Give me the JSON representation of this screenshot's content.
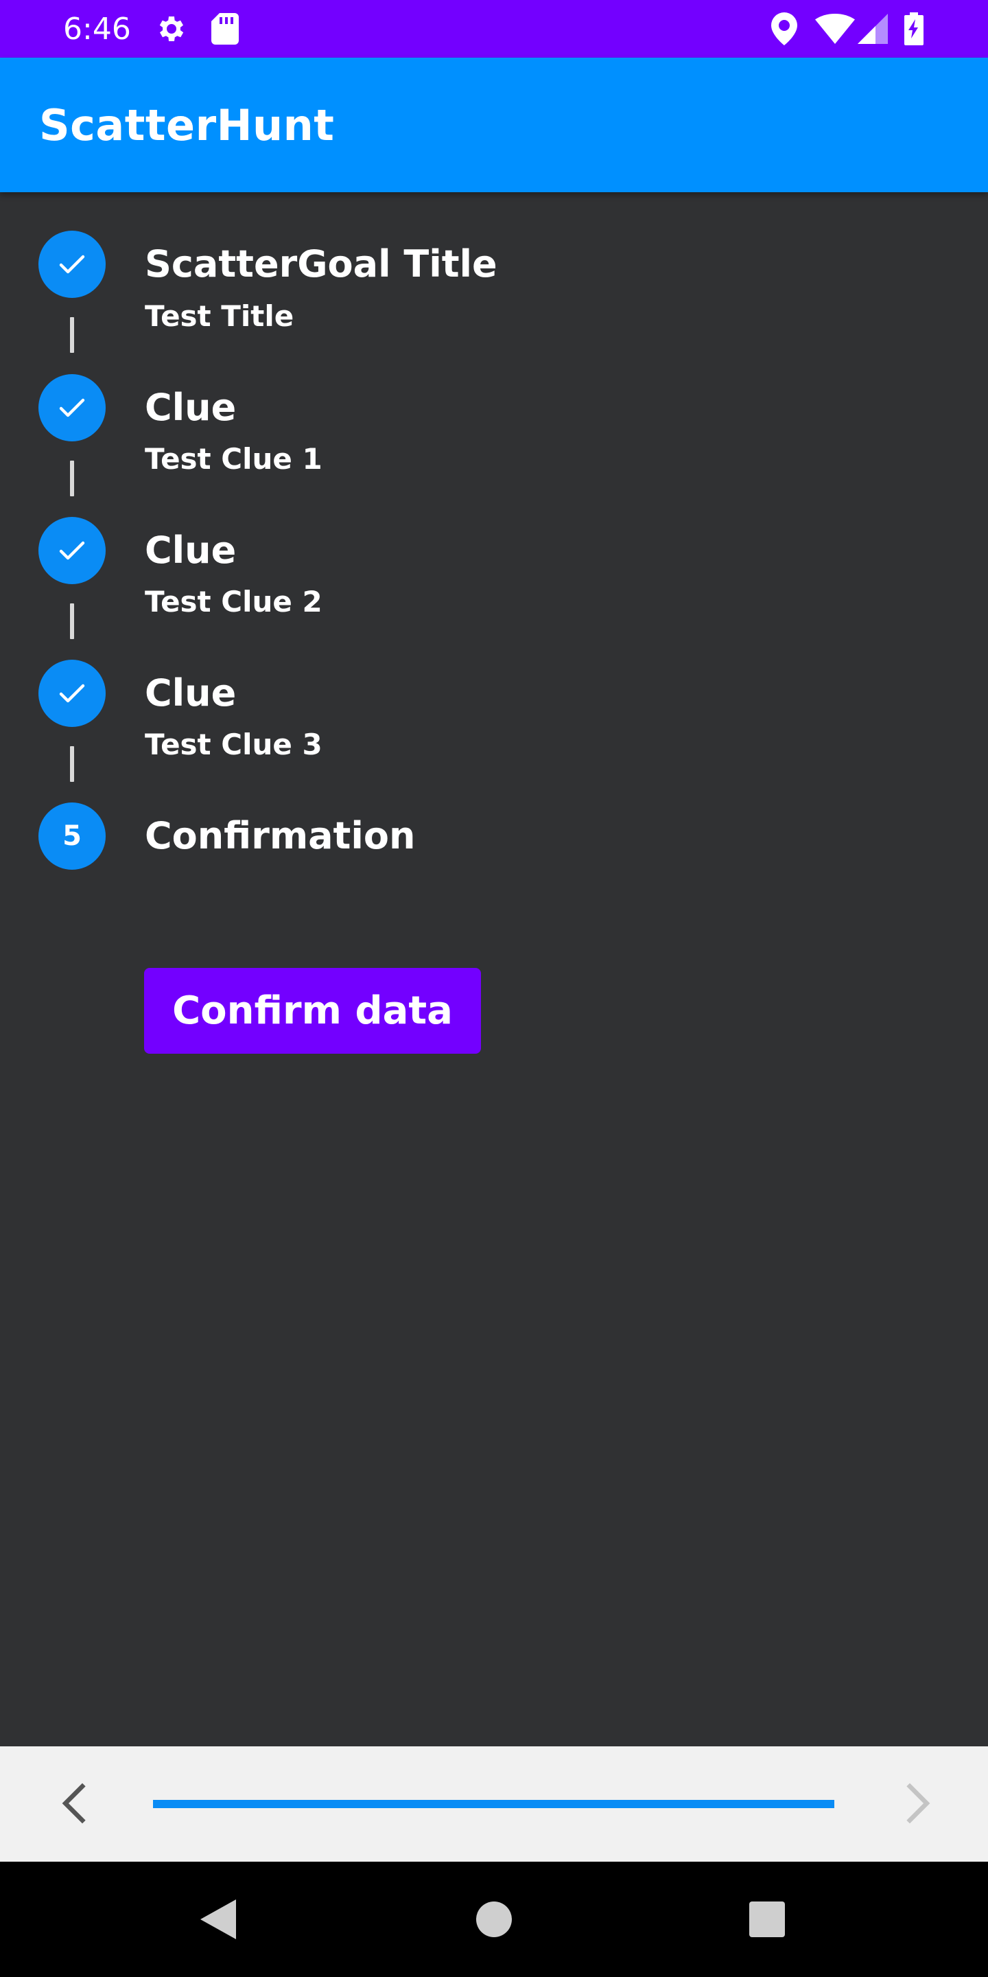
{
  "status_bar": {
    "time": "6:46",
    "background": "#7300ff",
    "left_icons": [
      "gear-icon",
      "sd-card-icon"
    ],
    "right_icons": [
      "location-pin-icon",
      "wifi-icon",
      "cell-signal-icon",
      "battery-charging-icon"
    ]
  },
  "app_bar": {
    "title": "ScatterHunt",
    "background": "#0090ff"
  },
  "stepper": {
    "steps": [
      {
        "state": "completed",
        "icon": "check-icon",
        "title": "ScatterGoal Title",
        "subtitle": "Test Title"
      },
      {
        "state": "completed",
        "icon": "check-icon",
        "title": "Clue",
        "subtitle": "Test Clue 1"
      },
      {
        "state": "completed",
        "icon": "check-icon",
        "title": "Clue",
        "subtitle": "Test Clue 2"
      },
      {
        "state": "completed",
        "icon": "check-icon",
        "title": "Clue",
        "subtitle": "Test Clue 3"
      },
      {
        "state": "active",
        "number": "5",
        "title": "Confirmation"
      }
    ],
    "confirm_button_label": "Confirm data",
    "accent_color": "#0a8cf5",
    "button_color": "#7300ff"
  },
  "bottom_nav": {
    "prev_icon": "chevron-left-icon",
    "next_icon": "chevron-right-icon",
    "next_enabled": false,
    "progress": 1.0
  },
  "system_nav": {
    "buttons": [
      "back-triangle-icon",
      "home-circle-icon",
      "recents-square-icon"
    ]
  }
}
